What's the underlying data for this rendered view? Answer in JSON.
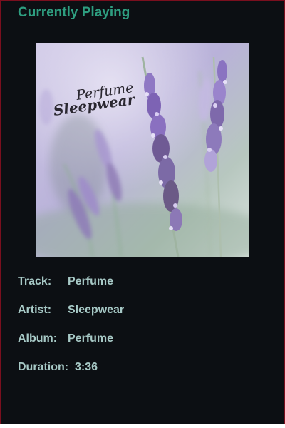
{
  "header": {
    "title": "Currently Playing"
  },
  "cover": {
    "artist_text": "Sleepwear",
    "title_text": "Perfume"
  },
  "details": {
    "track_label": "Track:",
    "track_value": "Perfume",
    "artist_label": "Artist:",
    "artist_value": "Sleepwear",
    "album_label": "Album:",
    "album_value": "Perfume",
    "duration_label": "Duration:",
    "duration_value": "3:36"
  },
  "colors": {
    "background": "#0c0f13",
    "accent": "#2e9e80",
    "text": "#a7c9c6",
    "border": "#7a0f1e"
  }
}
